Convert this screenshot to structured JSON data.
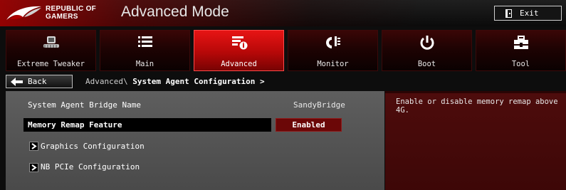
{
  "header": {
    "logo_text": "REPUBLIC OF GAMERS",
    "logo_line1": "REPUBLIC OF",
    "logo_line2": "GAMERS",
    "title": "Advanced Mode",
    "exit_label": "Exit"
  },
  "tabs": [
    {
      "label": "Extreme Tweaker",
      "icon": "tweaker-icon",
      "active": false
    },
    {
      "label": "Main",
      "icon": "list-icon",
      "active": false
    },
    {
      "label": "Advanced",
      "icon": "advanced-settings-icon",
      "active": true
    },
    {
      "label": "Monitor",
      "icon": "monitor-icon",
      "active": false
    },
    {
      "label": "Boot",
      "icon": "power-icon",
      "active": false
    },
    {
      "label": "Tool",
      "icon": "tool-icon",
      "active": false
    }
  ],
  "nav": {
    "back_label": "Back",
    "breadcrumb_parent": "Advanced\\",
    "breadcrumb_current": "System Agent Configuration >"
  },
  "settings": {
    "bridge_name_label": "System Agent Bridge Name",
    "bridge_name_value": "SandyBridge",
    "memory_remap_label": "Memory Remap Feature",
    "memory_remap_value": "Enabled",
    "submenus": [
      "Graphics Configuration",
      "NB PCIe Configuration"
    ]
  },
  "help": {
    "text": "Enable or disable memory remap above 4G."
  },
  "colors": {
    "accent_red": "#d10f0f",
    "panel_gray": "#555555",
    "help_red": "#460909",
    "selected_value_bg": "#6b0707"
  }
}
